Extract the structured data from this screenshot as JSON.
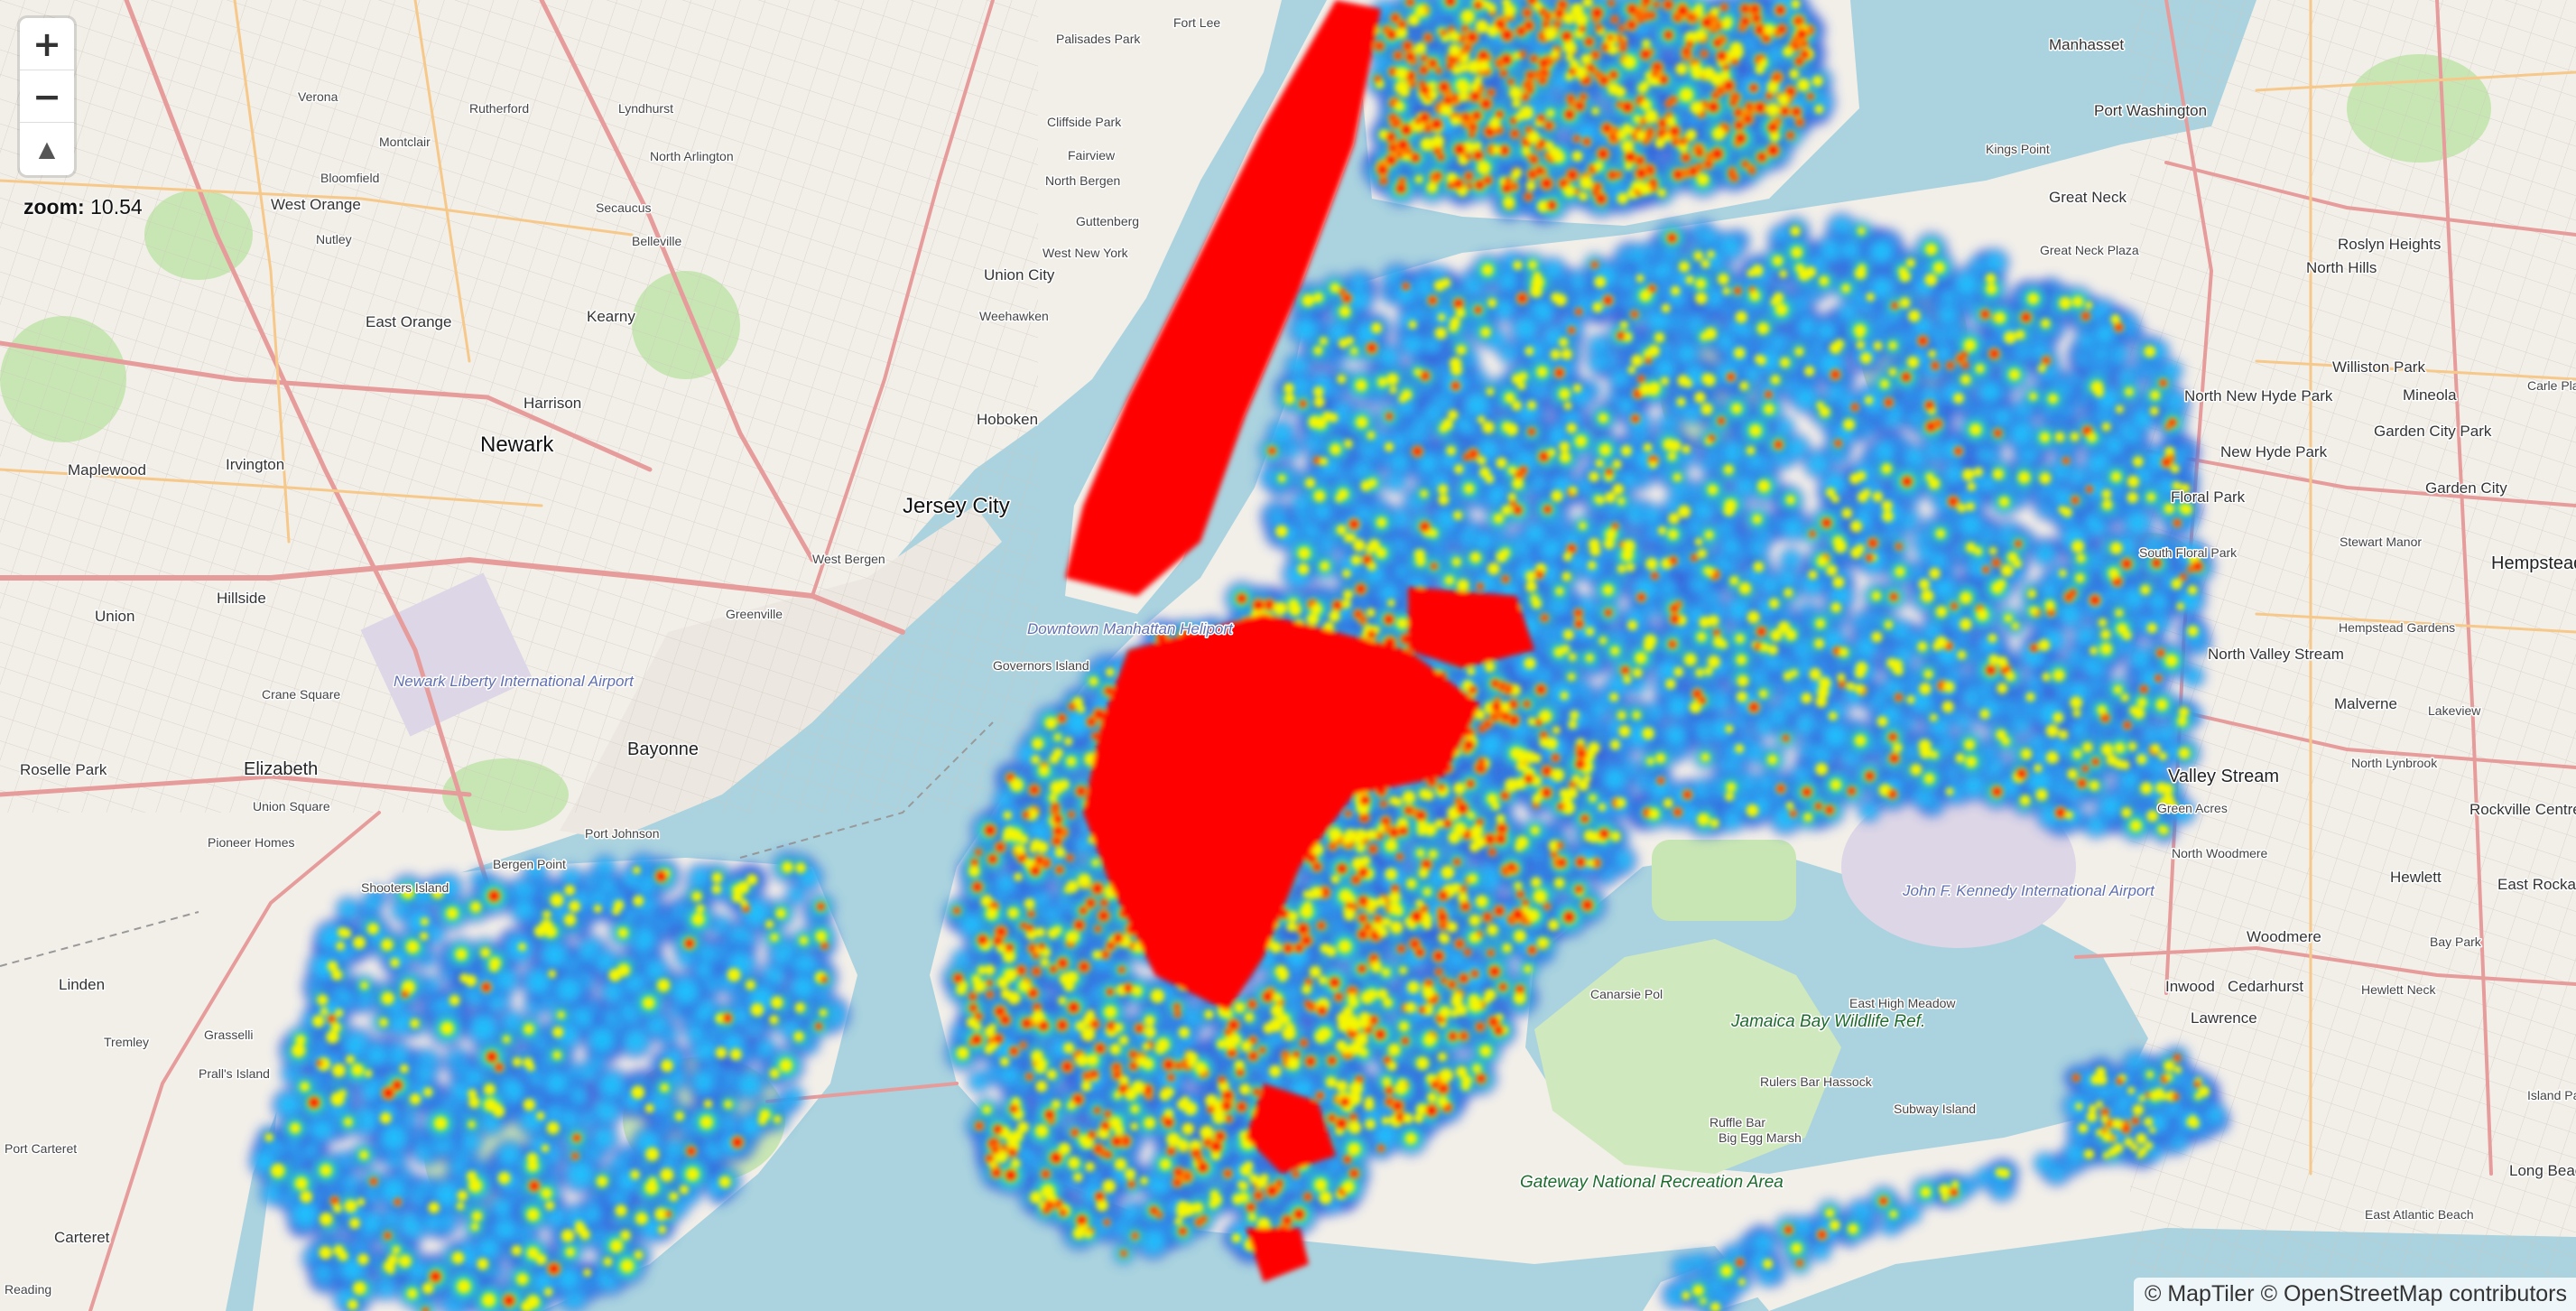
{
  "map": {
    "zoom_label": "zoom:",
    "zoom_value": "10.54",
    "attribution": "© MapTiler © OpenStreetMap contributors",
    "controls": {
      "zoom_in": "+",
      "zoom_out": "−",
      "compass": "▲"
    },
    "heatmap_colors": [
      "#3a56d8",
      "#1ec8ff",
      "#2ee87a",
      "#f6f600",
      "#ff0000"
    ],
    "place_labels": [
      {
        "text": "Newark",
        "size": "city"
      },
      {
        "text": "Jersey City",
        "size": "city"
      },
      {
        "text": "Hoboken",
        "size": "md"
      },
      {
        "text": "Elizabeth",
        "size": "lg"
      },
      {
        "text": "Bayonne",
        "size": "lg"
      },
      {
        "text": "Irvington",
        "size": "md"
      },
      {
        "text": "Maplewood",
        "size": "md"
      },
      {
        "text": "Hillside",
        "size": "md"
      },
      {
        "text": "Union",
        "size": "md"
      },
      {
        "text": "Linden",
        "size": "md"
      },
      {
        "text": "Roselle Park",
        "size": "md"
      },
      {
        "text": "Carteret",
        "size": "md"
      },
      {
        "text": "Kearny",
        "size": "md"
      },
      {
        "text": "Harrison",
        "size": "md"
      },
      {
        "text": "East Orange",
        "size": "md"
      },
      {
        "text": "West Orange",
        "size": "md"
      },
      {
        "text": "Montclair",
        "size": "sm"
      },
      {
        "text": "Verona",
        "size": "sm"
      },
      {
        "text": "Bloomfield",
        "size": "sm"
      },
      {
        "text": "Nutley",
        "size": "sm"
      },
      {
        "text": "Belleville",
        "size": "sm"
      },
      {
        "text": "North Arlington",
        "size": "sm"
      },
      {
        "text": "Lyndhurst",
        "size": "sm"
      },
      {
        "text": "Rutherford",
        "size": "sm"
      },
      {
        "text": "Secaucus",
        "size": "sm"
      },
      {
        "text": "Union City",
        "size": "md"
      },
      {
        "text": "Weehawken",
        "size": "sm"
      },
      {
        "text": "West New York",
        "size": "sm"
      },
      {
        "text": "Guttenberg",
        "size": "sm"
      },
      {
        "text": "North Bergen",
        "size": "sm"
      },
      {
        "text": "Fairview",
        "size": "sm"
      },
      {
        "text": "Cliffside Park",
        "size": "sm"
      },
      {
        "text": "Palisades Park",
        "size": "sm"
      },
      {
        "text": "Fort Lee",
        "size": "sm"
      },
      {
        "text": "Crane Square",
        "size": "sm"
      },
      {
        "text": "Union Square",
        "size": "sm"
      },
      {
        "text": "Pioneer Homes",
        "size": "sm"
      },
      {
        "text": "Bergen Point",
        "size": "sm"
      },
      {
        "text": "Port Johnson",
        "size": "sm"
      },
      {
        "text": "Shooters Island",
        "size": "sm"
      },
      {
        "text": "Governors Island",
        "size": "sm"
      },
      {
        "text": "Greenville",
        "size": "sm"
      },
      {
        "text": "West Bergen",
        "size": "sm"
      },
      {
        "text": "Grasselli",
        "size": "sm"
      },
      {
        "text": "Prall's Island",
        "size": "sm"
      },
      {
        "text": "Tremley",
        "size": "sm"
      },
      {
        "text": "Port Carteret",
        "size": "sm"
      },
      {
        "text": "Reading",
        "size": "sm"
      },
      {
        "text": "Manhasset",
        "size": "md"
      },
      {
        "text": "Great Neck",
        "size": "md"
      },
      {
        "text": "Kings Point",
        "size": "sm"
      },
      {
        "text": "Port Washington",
        "size": "md"
      },
      {
        "text": "Great Neck Plaza",
        "size": "sm"
      },
      {
        "text": "Roslyn Heights",
        "size": "md"
      },
      {
        "text": "North Hills",
        "size": "md"
      },
      {
        "text": "Williston Park",
        "size": "md"
      },
      {
        "text": "Mineola",
        "size": "md"
      },
      {
        "text": "Carle Place",
        "size": "sm"
      },
      {
        "text": "Garden City Park",
        "size": "md"
      },
      {
        "text": "Garden City",
        "size": "md"
      },
      {
        "text": "New Hyde Park",
        "size": "md"
      },
      {
        "text": "North New Hyde Park",
        "size": "md"
      },
      {
        "text": "Floral Park",
        "size": "md"
      },
      {
        "text": "South Floral Park",
        "size": "sm"
      },
      {
        "text": "Stewart Manor",
        "size": "sm"
      },
      {
        "text": "Hempstead",
        "size": "lg"
      },
      {
        "text": "Hempstead Gardens",
        "size": "sm"
      },
      {
        "text": "North Valley Stream",
        "size": "md"
      },
      {
        "text": "Malverne",
        "size": "md"
      },
      {
        "text": "Lakeview",
        "size": "sm"
      },
      {
        "text": "Valley Stream",
        "size": "lg"
      },
      {
        "text": "North Lynbrook",
        "size": "sm"
      },
      {
        "text": "Rockville Centre",
        "size": "md"
      },
      {
        "text": "Green Acres",
        "size": "sm"
      },
      {
        "text": "North Woodmere",
        "size": "sm"
      },
      {
        "text": "Hewlett",
        "size": "md"
      },
      {
        "text": "East Rockaway",
        "size": "md"
      },
      {
        "text": "Woodmere",
        "size": "md"
      },
      {
        "text": "Bay Park",
        "size": "sm"
      },
      {
        "text": "Hewlett Neck",
        "size": "sm"
      },
      {
        "text": "Inwood",
        "size": "md"
      },
      {
        "text": "Cedarhurst",
        "size": "md"
      },
      {
        "text": "Lawrence",
        "size": "md"
      },
      {
        "text": "Island Park",
        "size": "sm"
      },
      {
        "text": "East Atlantic Beach",
        "size": "sm"
      },
      {
        "text": "Long Beach",
        "size": "md"
      },
      {
        "text": "Canarsie Pol",
        "size": "sm"
      },
      {
        "text": "East High Meadow",
        "size": "sm"
      },
      {
        "text": "Rulers Bar Hassock",
        "size": "sm"
      },
      {
        "text": "Ruffle Bar",
        "size": "sm"
      },
      {
        "text": "Big Egg Marsh",
        "size": "sm"
      },
      {
        "text": "Subway Island",
        "size": "sm"
      }
    ],
    "park_labels": [
      {
        "text": "Jamaica Bay Wildlife Ref."
      },
      {
        "text": "Gateway National Recreation Area"
      }
    ],
    "airport_labels": [
      {
        "text": "Newark Liberty International Airport"
      },
      {
        "text": "John F. Kennedy International Airport"
      },
      {
        "text": "Downtown Manhattan Heliport"
      }
    ]
  }
}
